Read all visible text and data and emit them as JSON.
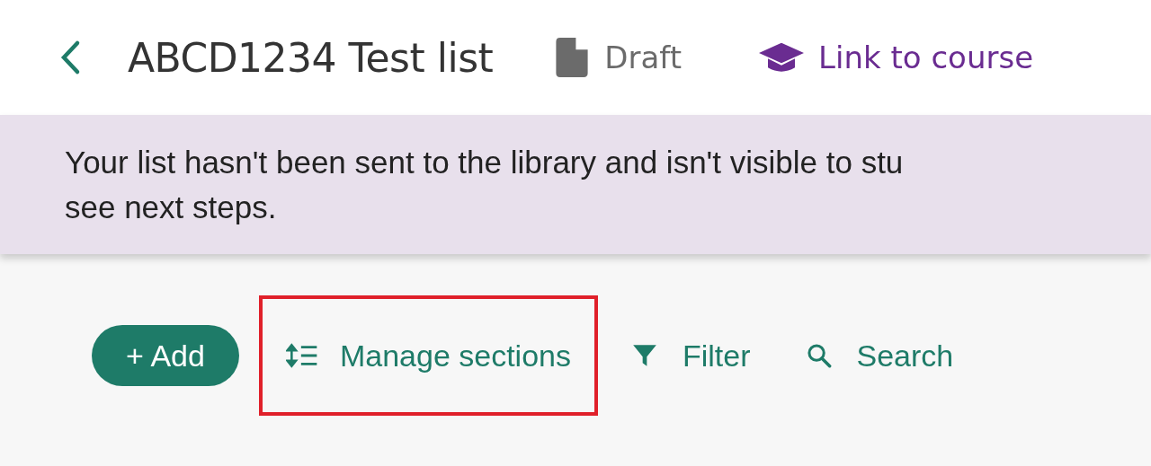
{
  "header": {
    "title": "ABCD1234 Test list",
    "status": "Draft",
    "course_link": "Link to course"
  },
  "banner": {
    "lines": [
      "Your list hasn't been sent to the library and isn't visible to stu",
      "see next steps."
    ]
  },
  "toolbar": [
    {
      "kind": "add",
      "label": "+ Add",
      "highlighted": false
    },
    {
      "kind": "manage",
      "label": "Manage sections",
      "highlighted": true
    },
    {
      "kind": "filter",
      "label": "Filter",
      "highlighted": false
    },
    {
      "kind": "search",
      "label": "Search",
      "highlighted": false
    }
  ]
}
